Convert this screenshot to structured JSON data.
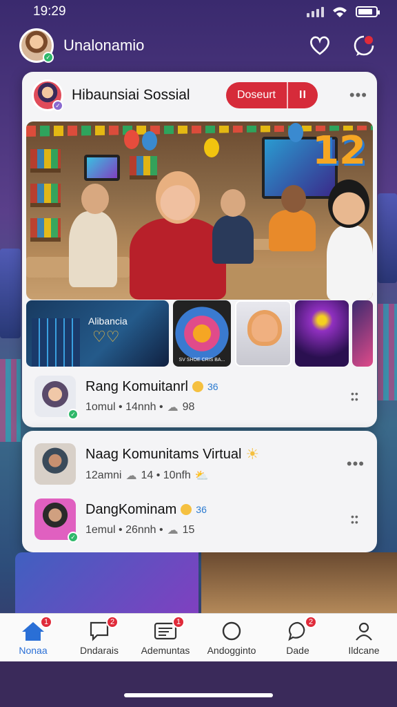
{
  "status_bar": {
    "time": "19:29"
  },
  "header": {
    "username": "Unalonamio"
  },
  "card1": {
    "title": "Hibaunsiai Sossial",
    "pill_label": "Doseurt",
    "pill_pause": "II",
    "more": "•••",
    "hero_badge": "12",
    "thumb1_text": "Alibancia",
    "thumb2_caption": "SV SHOE CRIS BA...",
    "post": {
      "title": "Rang Komuitanrl",
      "badge_count": "36",
      "sub_prefix": "1omul • 14nnh •",
      "sub_count": "98"
    }
  },
  "card2": {
    "more": "•••",
    "post1": {
      "title": "Naag Komunitams Virtual",
      "sub_a": "12amni",
      "sub_b": "14 • 10nfh"
    },
    "post2": {
      "title": "DangKominam",
      "badge_count": "36",
      "sub_prefix": "1emul • 26nnh •",
      "sub_count": "15"
    }
  },
  "tabs": [
    {
      "label": "Nonaa",
      "icon": "home-icon",
      "badge": "1",
      "active": true
    },
    {
      "label": "Dndarais",
      "icon": "chat-icon",
      "badge": "2"
    },
    {
      "label": "Ademuntas",
      "icon": "document-icon",
      "badge": "1"
    },
    {
      "label": "Andogginto",
      "icon": "circle-icon",
      "badge": ""
    },
    {
      "label": "Dade",
      "icon": "message-icon",
      "badge": "2"
    },
    {
      "label": "Ildcane",
      "icon": "person-icon",
      "badge": ""
    }
  ],
  "colors": {
    "accent": "#d62b3a",
    "active_tab": "#2a6fd6",
    "verified": "#2fb86a"
  }
}
